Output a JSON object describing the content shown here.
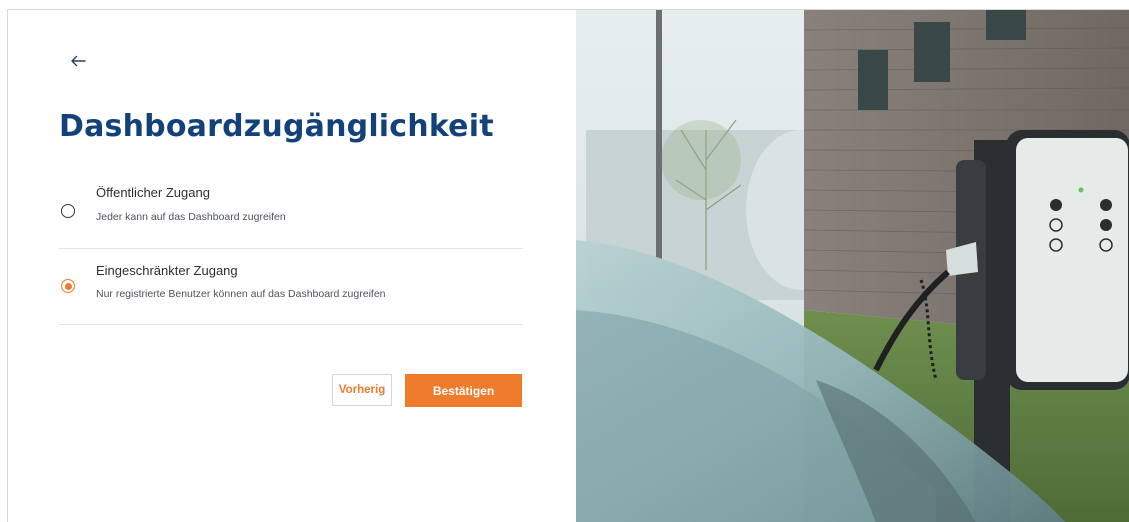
{
  "back": {
    "icon": "arrow-left-icon"
  },
  "page": {
    "title": "Dashboardzugänglichkeit"
  },
  "options": [
    {
      "title": "Öffentlicher Zugang",
      "description": "Jeder kann auf das Dashboard zugreifen",
      "selected": false
    },
    {
      "title": "Eingeschränkter Zugang",
      "description": "Nur registrierte Benutzer können auf das Dashboard zugreifen",
      "selected": true
    }
  ],
  "actions": {
    "previous_label": "Vorherig",
    "confirm_label": "Bestätigen"
  },
  "colors": {
    "accent": "#ef7b2d",
    "title": "#13427a"
  },
  "hero": {
    "icon": "ev-charging-station-photo"
  }
}
